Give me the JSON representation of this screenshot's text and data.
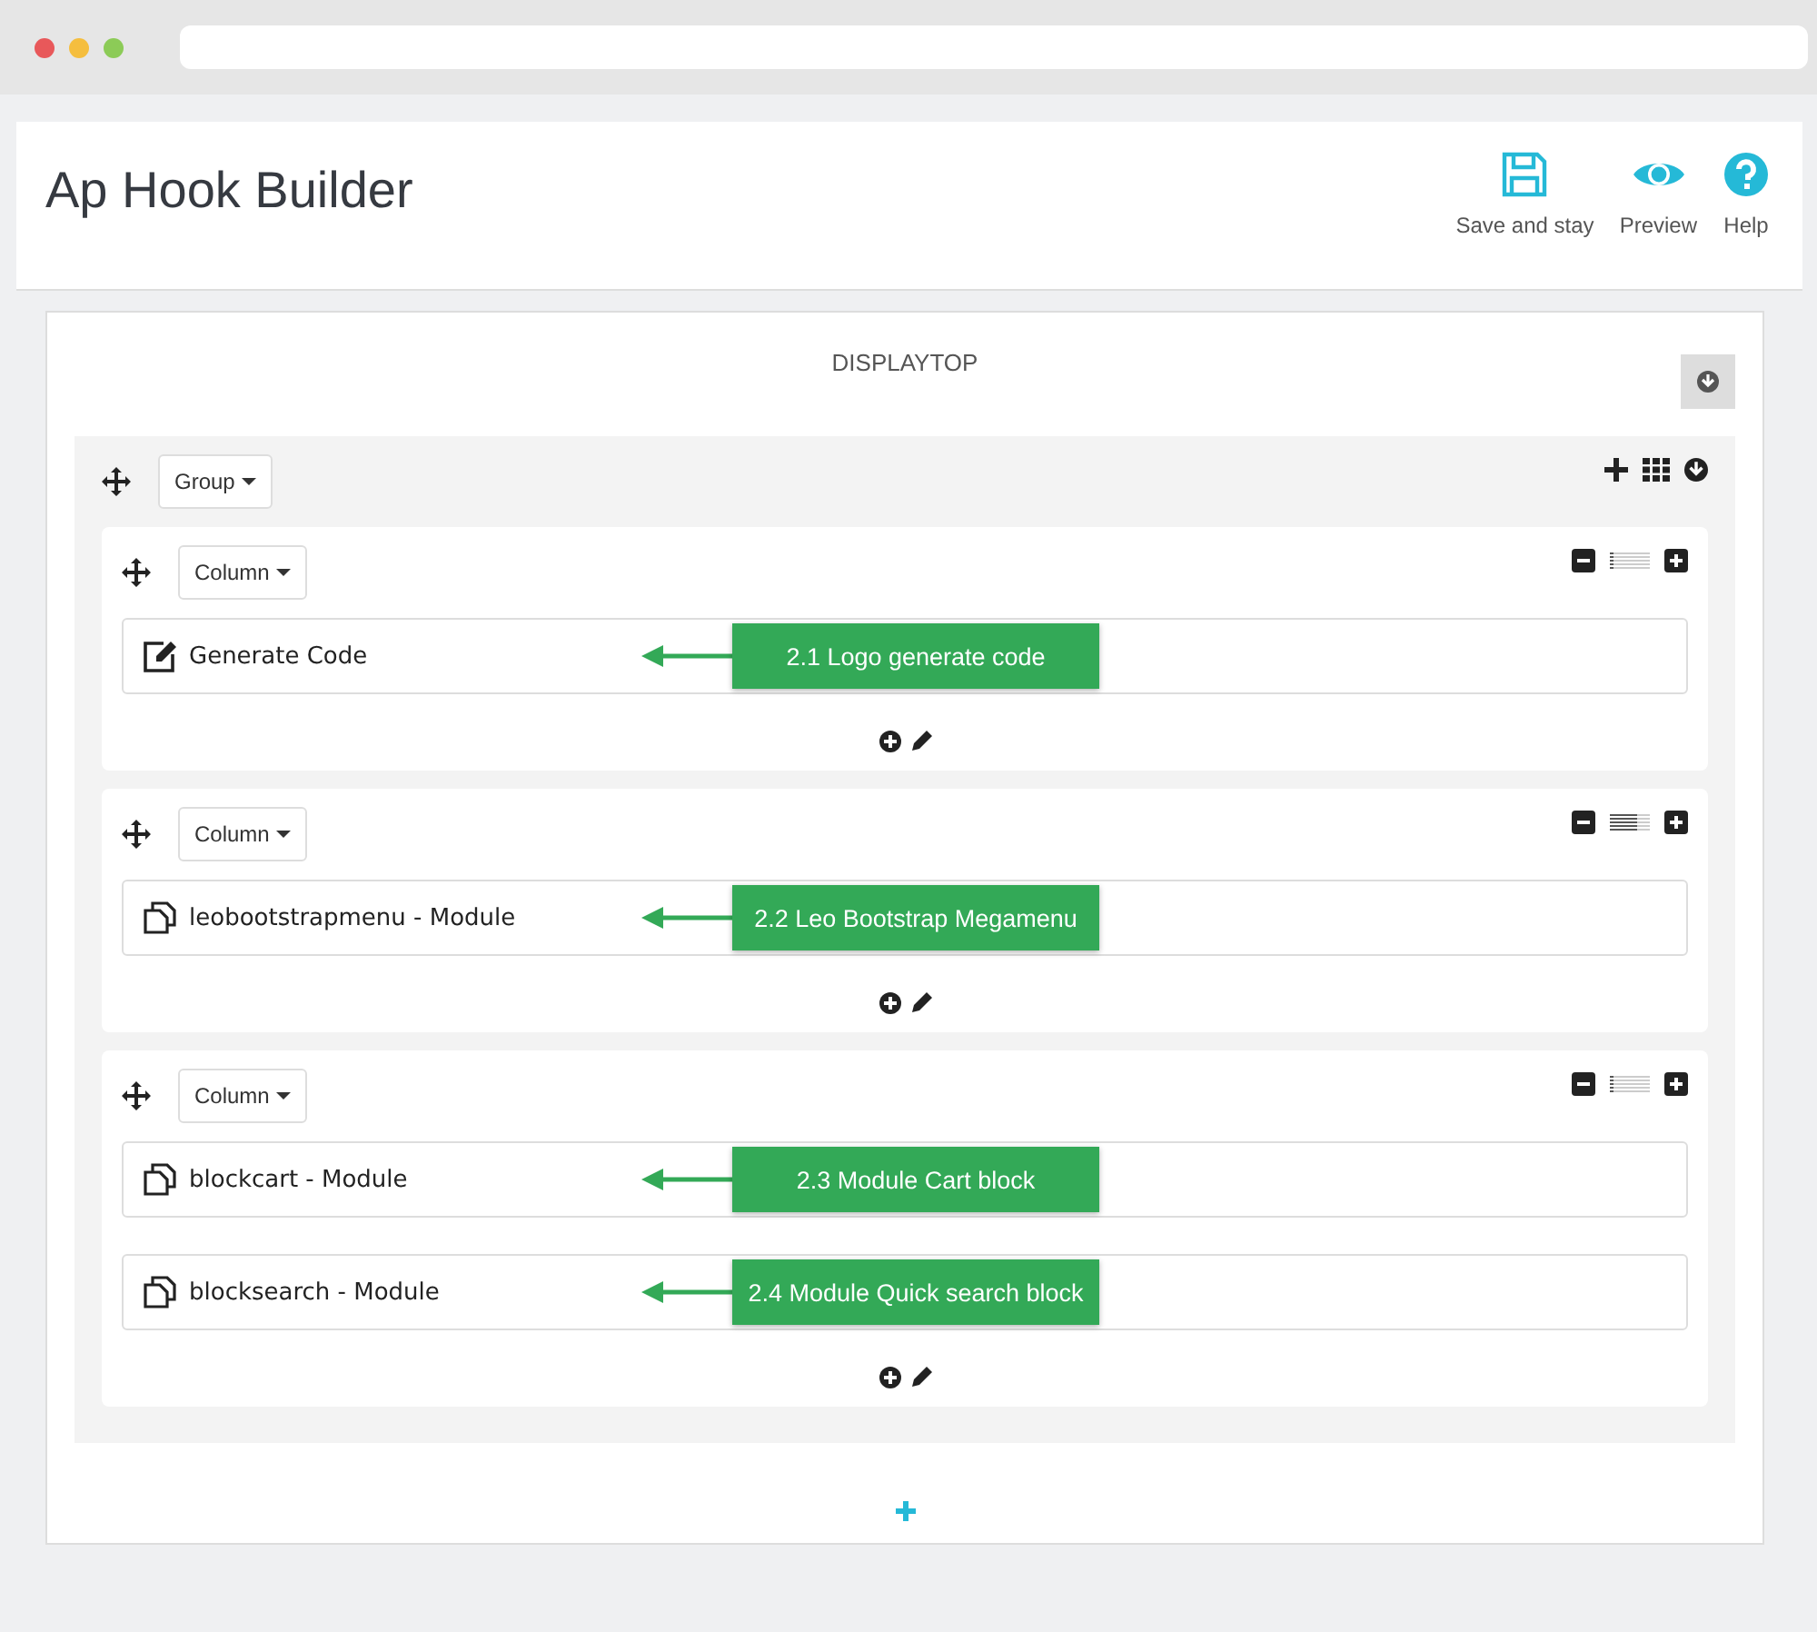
{
  "header": {
    "title": "Ap Hook Builder",
    "actions": [
      {
        "kind": "save",
        "label": "Save and stay"
      },
      {
        "kind": "preview",
        "label": "Preview"
      },
      {
        "kind": "help",
        "label": "Help"
      }
    ]
  },
  "hook": {
    "title": "DISPLAYTOP",
    "group": {
      "label": "Group",
      "columns": [
        {
          "label": "Column",
          "level": 0.08,
          "items": [
            {
              "kind": "code",
              "label": "Generate Code",
              "callout": "2.1 Logo generate code"
            }
          ]
        },
        {
          "label": "Column",
          "level": 0.67,
          "items": [
            {
              "kind": "module",
              "label": "leobootstrapmenu - Module",
              "callout": "2.2 Leo Bootstrap Megamenu"
            }
          ]
        },
        {
          "label": "Column",
          "level": 0.08,
          "items": [
            {
              "kind": "module",
              "label": "blockcart - Module",
              "callout": "2.3 Module Cart block"
            },
            {
              "kind": "module",
              "label": "blocksearch - Module",
              "callout": "2.4 Module Quick search block"
            }
          ]
        }
      ]
    }
  }
}
